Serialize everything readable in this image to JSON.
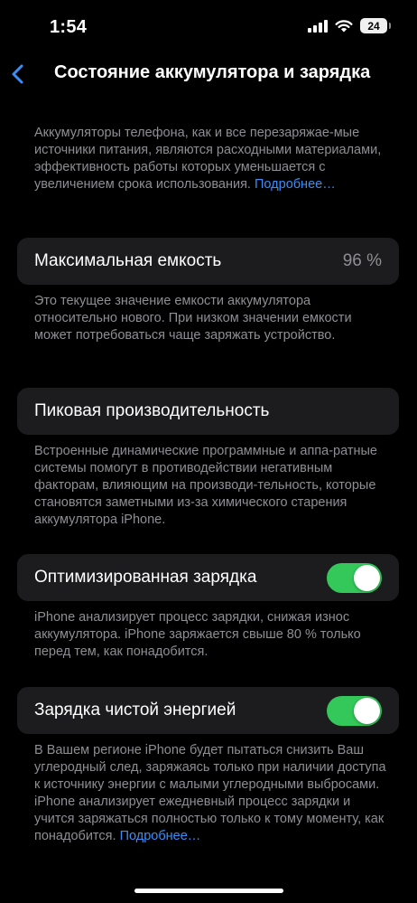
{
  "status": {
    "time": "1:54",
    "battery": "24"
  },
  "nav": {
    "title": "Состояние аккумулятора и зарядка"
  },
  "intro": {
    "text": "Аккумуляторы телефона, как и все перезаряжае-мые источники питания, являются расходными материалами, эффективность работы которых уменьшается с увеличением срока использования.",
    "link": "Подробнее…"
  },
  "capacity": {
    "label": "Максимальная емкость",
    "value": "96 %",
    "footer": "Это текущее значение емкости аккумулятора относительно нового. При низком значении емкости может потребоваться чаще заряжать устройство."
  },
  "peak": {
    "label": "Пиковая производительность",
    "footer": "Встроенные динамические программные и аппа-ратные системы помогут в противодействии негативным факторам, влияющим на производи-тельность, которые становятся заметными из-за химического старения аккумулятора iPhone."
  },
  "optimized": {
    "label": "Оптимизированная зарядка",
    "enabled": true,
    "footer": "iPhone анализирует процесс зарядки, снижая износ аккумулятора. iPhone заряжается свыше 80 % только перед тем, как понадобится."
  },
  "clean": {
    "label": "Зарядка чистой энергией",
    "enabled": true,
    "footer": "В Вашем регионе iPhone будет пытаться снизить Ваш углеродный след, заряжаясь только при наличии доступа к источнику энергии с малыми углеродными выбросами. iPhone анализирует ежедневный процесс зарядки и учится заряжаться полностью только к тому моменту, как понадобится.",
    "link": "Подробнее…"
  }
}
